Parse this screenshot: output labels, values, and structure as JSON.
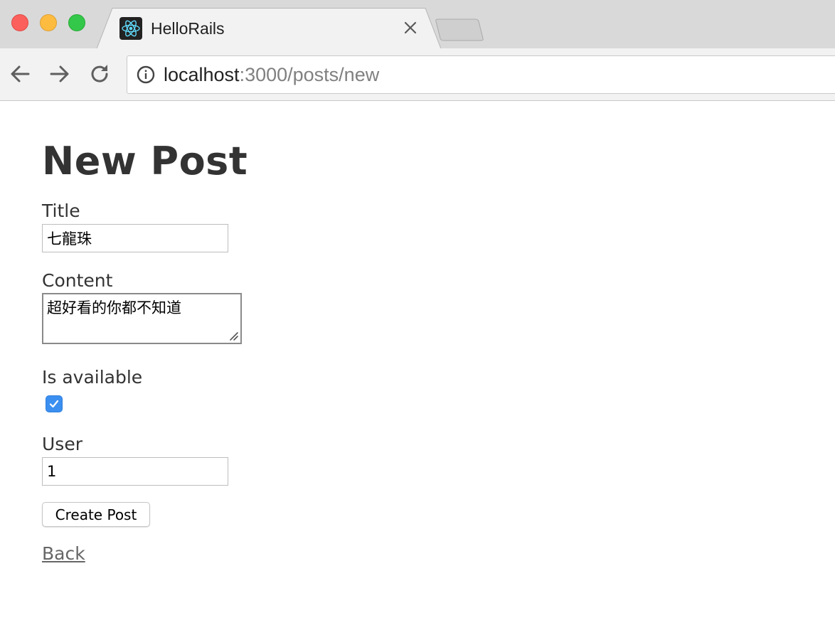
{
  "browser": {
    "tab_title": "HelloRails",
    "url_host": "localhost",
    "url_rest": ":3000/posts/new",
    "icons": {
      "favicon": "react-atom-icon",
      "tab_close": "close-icon",
      "back": "arrow-left-icon",
      "forward": "arrow-right-icon",
      "reload": "reload-icon",
      "site_info": "info-icon"
    },
    "colors": {
      "tab_bar": "#d9d9d9",
      "active_tab": "#f2f2f2",
      "favicon_accent": "#61dafb"
    }
  },
  "page": {
    "title": "New Post",
    "fields": {
      "title": {
        "label": "Title",
        "value": "七龍珠"
      },
      "content": {
        "label": "Content",
        "value": "超好看的你都不知道"
      },
      "is_available": {
        "label": "Is available",
        "checked": true
      },
      "user": {
        "label": "User",
        "value": "1"
      }
    },
    "submit_label": "Create Post",
    "back_link": "Back",
    "colors": {
      "checkbox_accent": "#3b8ff0",
      "text": "#333333",
      "link": "#666666"
    }
  }
}
